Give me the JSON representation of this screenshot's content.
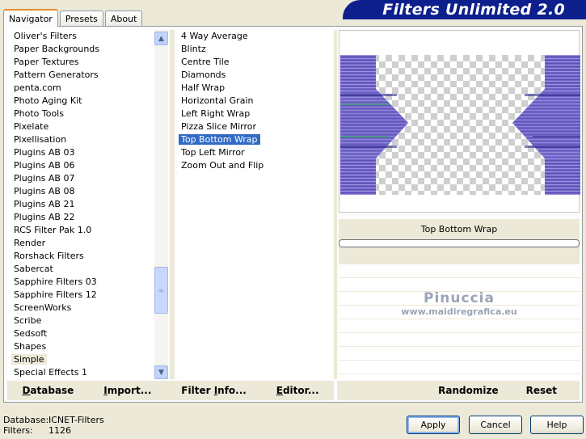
{
  "tabs": [
    {
      "label": "Navigator"
    },
    {
      "label": "Presets"
    },
    {
      "label": "About"
    }
  ],
  "banner_title": "Filters Unlimited 2.0",
  "categories": [
    "Oliver's Filters",
    "Paper Backgrounds",
    "Paper Textures",
    "Pattern Generators",
    "penta.com",
    "Photo Aging Kit",
    "Photo Tools",
    "Pixelate",
    "Pixellisation",
    "Plugins AB 03",
    "Plugins AB 06",
    "Plugins AB 07",
    "Plugins AB 08",
    "Plugins AB 21",
    "Plugins AB 22",
    "RCS Filter Pak 1.0",
    "Render",
    "Rorshack Filters",
    "Sabercat",
    "Sapphire Filters 03",
    "Sapphire Filters 12",
    "ScreenWorks",
    "Scribe",
    "Sedsoft",
    "Shapes",
    "Simple",
    "Special Effects 1"
  ],
  "selected_category": "Simple",
  "filters": [
    "4 Way Average",
    "Blintz",
    "Centre Tile",
    "Diamonds",
    "Half Wrap",
    "Horizontal Grain",
    "Left Right Wrap",
    "Pizza Slice Mirror",
    "Top Bottom Wrap",
    "Top Left Mirror",
    "Zoom Out and Flip"
  ],
  "selected_filter": "Top Bottom Wrap",
  "preview": {
    "filter_name": "Top Bottom Wrap",
    "progress": 0,
    "watermark_title": "Pinuccia",
    "watermark_url": "www.maidiregrafica.eu",
    "colors": {
      "purple": "#7568c8",
      "dark_purple": "#2d2a8a",
      "checker": "#cfcfcf"
    }
  },
  "actions_left": [
    {
      "label": "Database",
      "underline": "D",
      "rest": "atabase"
    },
    {
      "label": "Import...",
      "underline": "I",
      "rest": "mport..."
    },
    {
      "label": "Filter Info...",
      "pre": "Filter ",
      "underline": "I",
      "rest": "nfo..."
    },
    {
      "label": "Editor...",
      "underline": "E",
      "rest": "ditor..."
    }
  ],
  "actions_right": [
    {
      "label": "Randomize"
    },
    {
      "label": "Reset"
    }
  ],
  "status": {
    "database_label": "Database:",
    "database_value": "ICNET-Filters",
    "filters_label": "Filters:",
    "filters_value": "1126"
  },
  "buttons": {
    "apply": "Apply",
    "cancel": "Cancel",
    "help": "Help"
  },
  "icons": {
    "scroll_up": "chevron-up-icon",
    "scroll_down": "chevron-down-icon"
  }
}
